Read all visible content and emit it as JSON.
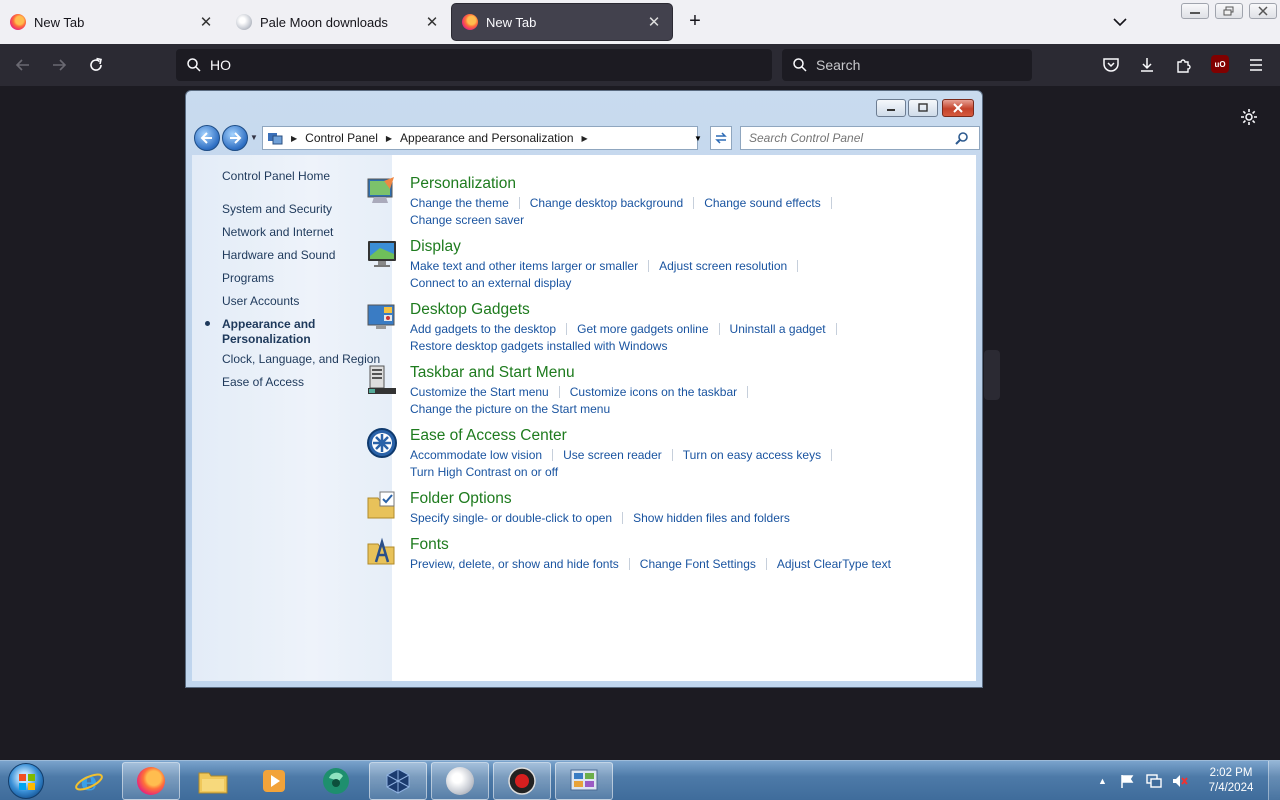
{
  "browser": {
    "tabs": [
      {
        "title": "New Tab",
        "icon": "firefox-icon",
        "active": false
      },
      {
        "title": "Pale Moon downloads",
        "icon": "palemoon-icon",
        "active": false
      },
      {
        "title": "New Tab",
        "icon": "firefox-icon",
        "active": true
      }
    ],
    "url_value": "HO",
    "search_placeholder": "Search",
    "ublock_label": "uO"
  },
  "control_panel": {
    "breadcrumbs": [
      "Control Panel",
      "Appearance and Personalization"
    ],
    "search_placeholder": "Search Control Panel",
    "sidebar": {
      "home": "Control Panel Home",
      "items": [
        "System and Security",
        "Network and Internet",
        "Hardware and Sound",
        "Programs",
        "User Accounts",
        "Appearance and Personalization",
        "Clock, Language, and Region",
        "Ease of Access"
      ],
      "current_index": 5
    },
    "categories": [
      {
        "title": "Personalization",
        "icon": "personalization-icon",
        "line1": [
          "Change the theme",
          "Change desktop background",
          "Change sound effects"
        ],
        "line2": [
          "Change screen saver"
        ]
      },
      {
        "title": "Display",
        "icon": "display-icon",
        "line1": [
          "Make text and other items larger or smaller",
          "Adjust screen resolution"
        ],
        "line2": [
          "Connect to an external display"
        ]
      },
      {
        "title": "Desktop Gadgets",
        "icon": "gadgets-icon",
        "line1": [
          "Add gadgets to the desktop",
          "Get more gadgets online",
          "Uninstall a gadget"
        ],
        "line2": [
          "Restore desktop gadgets installed with Windows"
        ]
      },
      {
        "title": "Taskbar and Start Menu",
        "icon": "taskbar-icon",
        "line1": [
          "Customize the Start menu",
          "Customize icons on the taskbar"
        ],
        "line2": [
          "Change the picture on the Start menu"
        ]
      },
      {
        "title": "Ease of Access Center",
        "icon": "ease-of-access-icon",
        "line1": [
          "Accommodate low vision",
          "Use screen reader",
          "Turn on easy access keys"
        ],
        "line2": [
          "Turn High Contrast on or off"
        ]
      },
      {
        "title": "Folder Options",
        "icon": "folder-options-icon",
        "line1": [
          "Specify single- or double-click to open",
          "Show hidden files and folders"
        ],
        "line2": []
      },
      {
        "title": "Fonts",
        "icon": "fonts-icon",
        "line1": [
          "Preview, delete, or show and hide fonts",
          "Change Font Settings",
          "Adjust ClearType text"
        ],
        "line2": []
      }
    ]
  },
  "taskbar": {
    "apps": [
      "internet-explorer",
      "firefox",
      "file-explorer",
      "media-player",
      "app-green",
      "virtualbox",
      "pale-moon",
      "recorder",
      "control-panel"
    ],
    "open_apps": [
      "firefox",
      "virtualbox",
      "pale-moon",
      "recorder",
      "control-panel"
    ],
    "clock_time": "2:02 PM",
    "clock_date": "7/4/2024"
  },
  "colors": {
    "browser_dark": "#2b2a33",
    "cp_link": "#1a54a0",
    "cp_title_green": "#1e7b1e"
  }
}
